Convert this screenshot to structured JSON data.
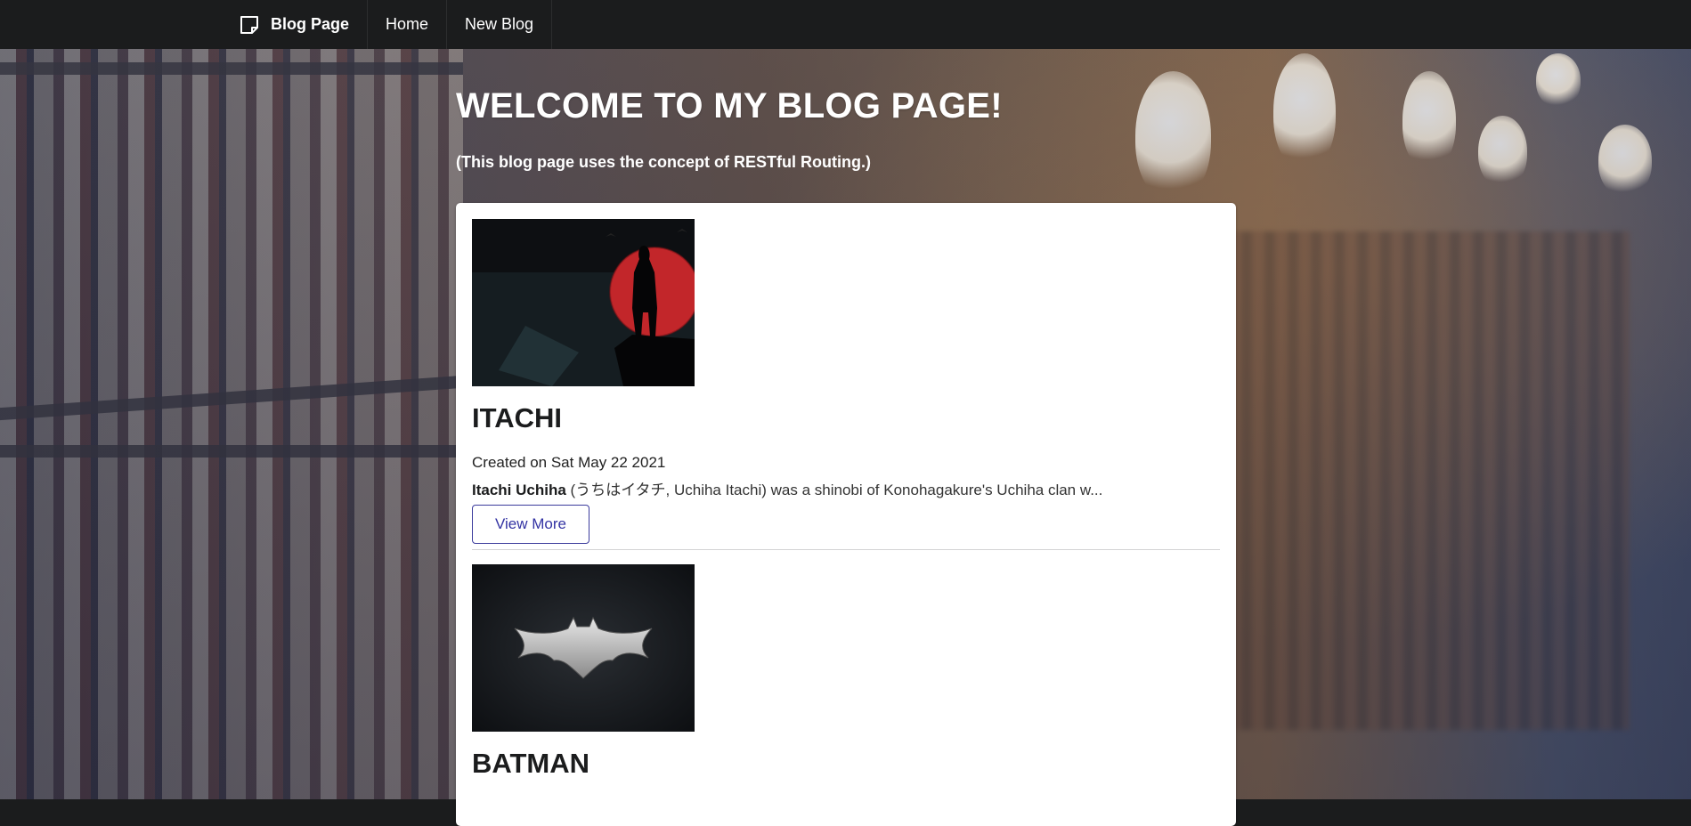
{
  "nav": {
    "brand": "Blog Page",
    "links": [
      "Home",
      "New Blog"
    ]
  },
  "hero": {
    "title": "WELCOME TO MY BLOG PAGE!",
    "subtitle": "(This blog page uses the concept of RESTful Routing.)"
  },
  "posts": [
    {
      "title": "ITACHI",
      "created": "Created on Sat May 22 2021",
      "snippet_bold": "Itachi Uchiha",
      "snippet_rest": " (うちはイタチ, Uchiha Itachi) was a shinobi of Konohagakure's Uchiha clan w...",
      "button": "View More"
    },
    {
      "title": "BATMAN"
    }
  ],
  "colors": {
    "navbar": "#1b1c1d",
    "button_border": "#3b3b9c",
    "itachi_moon": "#c2262a"
  }
}
